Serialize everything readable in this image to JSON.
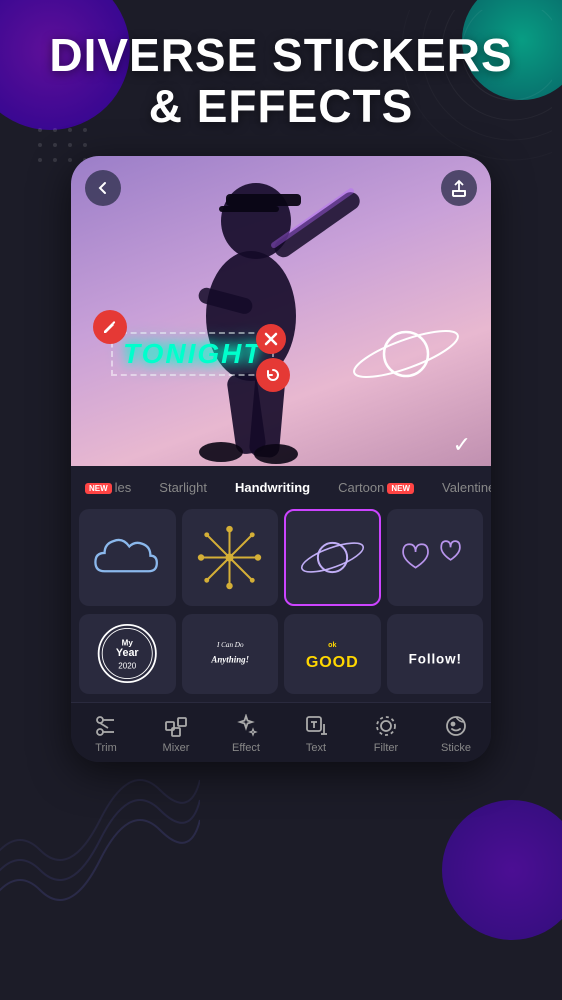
{
  "title": {
    "line1": "DIVERSE STICKERS",
    "line2": "& EFFECTS"
  },
  "video": {
    "back_label": "‹",
    "share_label": "⬆",
    "tonight_text": "TONIGHT",
    "checkmark": "✓"
  },
  "categories": [
    {
      "id": "tiles",
      "label": "les",
      "new": false,
      "active": false
    },
    {
      "id": "starlight",
      "label": "Starlight",
      "new": true,
      "active": false
    },
    {
      "id": "handwriting",
      "label": "Handwriting",
      "new": false,
      "active": true
    },
    {
      "id": "cartoon",
      "label": "Cartoon",
      "new": false,
      "active": false
    },
    {
      "id": "valentine",
      "label": "Valentine",
      "new": true,
      "active": false
    }
  ],
  "stickers_row1": [
    {
      "id": "cloud-sticker",
      "selected": false,
      "type": "cloud"
    },
    {
      "id": "star-sticker",
      "selected": false,
      "type": "star"
    },
    {
      "id": "planet-sticker",
      "selected": true,
      "type": "planet"
    },
    {
      "id": "heart-sticker",
      "selected": false,
      "type": "hearts"
    }
  ],
  "stickers_row2": [
    {
      "id": "my-year-sticker",
      "text": "My Year 2020",
      "type": "badge"
    },
    {
      "id": "can-do-sticker",
      "text": "I Can Do Anything!",
      "type": "script"
    },
    {
      "id": "good-sticker",
      "text": "GOOD",
      "type": "graffiti"
    },
    {
      "id": "follow-sticker",
      "text": "Follow!",
      "type": "bold"
    }
  ],
  "toolbar": [
    {
      "id": "trim",
      "label": "Trim",
      "icon": "scissors"
    },
    {
      "id": "mixer",
      "label": "Mixer",
      "icon": "layers"
    },
    {
      "id": "effect",
      "label": "Effect",
      "icon": "sparkle"
    },
    {
      "id": "text",
      "label": "Text",
      "icon": "text-add"
    },
    {
      "id": "filter",
      "label": "Filter",
      "icon": "filter"
    },
    {
      "id": "sticker",
      "label": "Sticke",
      "icon": "sticker"
    }
  ],
  "colors": {
    "accent_purple": "#cc44ff",
    "accent_cyan": "#00ffcc",
    "bg_dark": "#1e1e2e",
    "red_btn": "#e53935"
  }
}
